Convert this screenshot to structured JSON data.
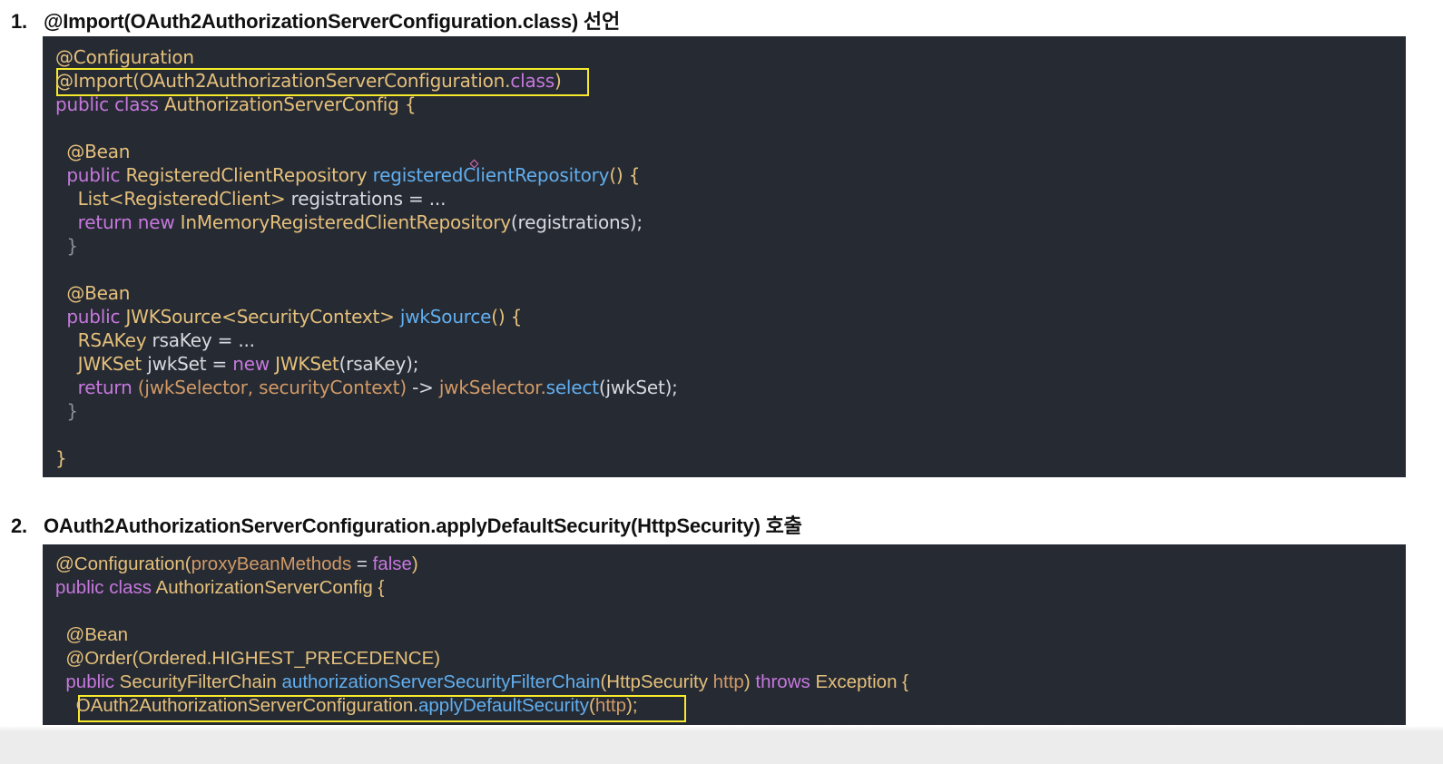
{
  "sections": [
    {
      "number": "1.",
      "title": "@Import(OAuth2AuthorizationServerConfiguration.class) 선언",
      "code": [
        [
          {
            "t": "@Configuration",
            "c": "yellow"
          }
        ],
        [
          {
            "t": "@Import(OAuth2AuthorizationServerConfiguration.",
            "c": "yellow"
          },
          {
            "t": "class",
            "c": "purple"
          },
          {
            "t": ")",
            "c": "yellow"
          }
        ],
        [
          {
            "t": "public class ",
            "c": "purple"
          },
          {
            "t": "AuthorizationServerConfig ",
            "c": "yellow"
          },
          {
            "t": "{",
            "c": "yellow"
          }
        ],
        [],
        [
          {
            "t": "  @Bean",
            "c": "yellow"
          }
        ],
        [
          {
            "t": "  public ",
            "c": "purple"
          },
          {
            "t": "RegisteredClientRepository ",
            "c": "yellow"
          },
          {
            "t": "registeredClientRepository",
            "c": "blue"
          },
          {
            "t": "() {",
            "c": "yellow"
          }
        ],
        [
          {
            "t": "    List<RegisteredClient> ",
            "c": "yellow"
          },
          {
            "t": "registrations = ...",
            "c": "white"
          }
        ],
        [
          {
            "t": "    return new ",
            "c": "purple"
          },
          {
            "t": "InMemoryRegisteredClientRepository",
            "c": "yellow"
          },
          {
            "t": "(registrations);",
            "c": "white"
          }
        ],
        [
          {
            "t": "  }",
            "c": "dim"
          }
        ],
        [],
        [
          {
            "t": "  @Bean",
            "c": "yellow"
          }
        ],
        [
          {
            "t": "  public ",
            "c": "purple"
          },
          {
            "t": "JWKSource<SecurityContext> ",
            "c": "yellow"
          },
          {
            "t": "jwkSource",
            "c": "blue"
          },
          {
            "t": "() {",
            "c": "yellow"
          }
        ],
        [
          {
            "t": "    RSAKey ",
            "c": "yellow"
          },
          {
            "t": "rsaKey = ...",
            "c": "white"
          }
        ],
        [
          {
            "t": "    JWKSet ",
            "c": "yellow"
          },
          {
            "t": "jwkSet = ",
            "c": "white"
          },
          {
            "t": "new ",
            "c": "purple"
          },
          {
            "t": "JWKSet",
            "c": "yellow"
          },
          {
            "t": "(rsaKey);",
            "c": "white"
          }
        ],
        [
          {
            "t": "    return ",
            "c": "purple"
          },
          {
            "t": "(jwkSelector, securityContext) ",
            "c": "orange"
          },
          {
            "t": "-> ",
            "c": "white"
          },
          {
            "t": "jwkSelector.",
            "c": "orange"
          },
          {
            "t": "select",
            "c": "blue"
          },
          {
            "t": "(jwkSet);",
            "c": "white"
          }
        ],
        [
          {
            "t": "  }",
            "c": "dim"
          }
        ],
        [],
        [
          {
            "t": "}",
            "c": "yellow"
          }
        ]
      ]
    },
    {
      "number": "2.",
      "title": "OAuth2AuthorizationServerConfiguration.applyDefaultSecurity(HttpSecurity) 호출",
      "code": [
        [
          {
            "t": "@Configuration(",
            "c": "yellow"
          },
          {
            "t": "proxyBeanMethods",
            "c": "orange"
          },
          {
            "t": " = ",
            "c": "white"
          },
          {
            "t": "false",
            "c": "purple"
          },
          {
            "t": ")",
            "c": "yellow"
          }
        ],
        [
          {
            "t": "public class ",
            "c": "purple"
          },
          {
            "t": "AuthorizationServerConfig {",
            "c": "yellow"
          }
        ],
        [],
        [
          {
            "t": "  @Bean",
            "c": "yellow"
          }
        ],
        [
          {
            "t": "  @Order(Ordered.HIGHEST_PRECEDENCE)",
            "c": "yellow"
          }
        ],
        [
          {
            "t": "  public ",
            "c": "purple"
          },
          {
            "t": "SecurityFilterChain ",
            "c": "yellow"
          },
          {
            "t": "authorizationServerSecurityFilterChain",
            "c": "blue"
          },
          {
            "t": "(HttpSecurity ",
            "c": "yellow"
          },
          {
            "t": "http",
            "c": "orange"
          },
          {
            "t": ") ",
            "c": "yellow"
          },
          {
            "t": "throws ",
            "c": "purple"
          },
          {
            "t": "Exception {",
            "c": "yellow"
          }
        ],
        [
          {
            "t": "    OAuth2AuthorizationServerConfiguration.",
            "c": "yellow"
          },
          {
            "t": "applyDefaultSecurity",
            "c": "blue"
          },
          {
            "t": "(",
            "c": "yellow"
          },
          {
            "t": "http",
            "c": "orange"
          },
          {
            "t": ");",
            "c": "yellow"
          }
        ]
      ]
    }
  ],
  "colors": {
    "yellow": "#e5c07b",
    "purple": "#c678dd",
    "blue": "#61afef",
    "orange": "#d19a66",
    "white": "#d7dae0",
    "dim": "#8b8f96",
    "highlight_box": "#f5ea2c"
  }
}
